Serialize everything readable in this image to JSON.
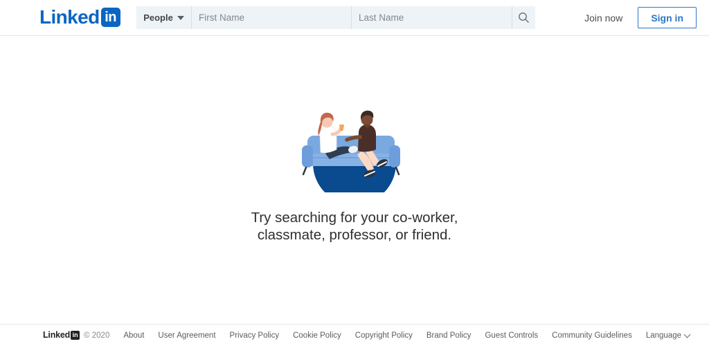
{
  "header": {
    "logo": {
      "text": "Linked",
      "badge": "in",
      "color": "#0a66c2"
    },
    "search": {
      "facet_label": "People",
      "facet_icon": "caret-down-icon",
      "first_name_placeholder": "First Name",
      "first_name_value": "",
      "last_name_placeholder": "Last Name",
      "last_name_value": "",
      "search_icon": "search-icon"
    },
    "join_now_label": "Join now",
    "sign_in_label": "Sign in",
    "accent_color": "#2977c9"
  },
  "main": {
    "illustration_name": "two-people-on-couch-illustration",
    "message_line_1": "Try searching for your co-worker,",
    "message_line_2": "classmate, professor, or friend.",
    "illustration_colors": {
      "semicircle": "#0a4a8f",
      "couch": "#7aa9e0",
      "couch_shadow": "#5e93d1",
      "skin_light": "#f6c9b4",
      "skin_dark": "#7a4a33",
      "hair_left": "#c4674a",
      "hair_right": "#3a2a22",
      "shirt_left": "#ffffff",
      "shirt_right": "#4a2e28",
      "pants_left": "#2e3d52",
      "pants_right": "#ffd9c4",
      "shoes": "#2a3442"
    }
  },
  "footer": {
    "logo": {
      "text": "Linked",
      "badge": "in"
    },
    "copyright": "© 2020",
    "links": [
      "About",
      "User Agreement",
      "Privacy Policy",
      "Cookie Policy",
      "Copyright Policy",
      "Brand Policy",
      "Guest Controls",
      "Community Guidelines"
    ],
    "language_label": "Language",
    "language_icon": "chevron-down-icon"
  }
}
